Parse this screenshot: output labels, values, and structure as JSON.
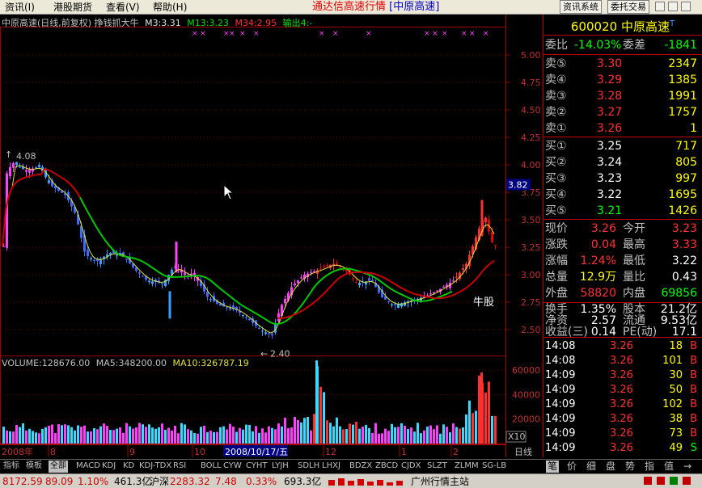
{
  "menu": [
    "资讯(I)",
    "港股期货",
    "查看(V)",
    "帮助(H)"
  ],
  "title": {
    "prefix": "通达信高速行情",
    "bracket": "[中原高速]"
  },
  "top_buttons": [
    "资讯系统",
    "委托交易"
  ],
  "chart_header": {
    "name": "中原高速(日线,前复权) 挣钱抓大牛",
    "m3": "M3:3.31",
    "m13": "M13:3.23",
    "m34": "M34:2.95",
    "out": "输出4:-"
  },
  "price_axis": [
    "5.00",
    "4.75",
    "4.50",
    "4.25",
    "4.00",
    "3.75",
    "3.50",
    "3.25",
    "3.00",
    "2.75",
    "2.50"
  ],
  "price_marker": "3.82",
  "annotations": {
    "high": "4.08",
    "low": "2.40",
    "bull": "牛股"
  },
  "volume_header": {
    "vol": "VOLUME:128676.00",
    "ma5": "MA5:348200.00",
    "ma10": "MA10:326787.19"
  },
  "volume_axis": [
    "60000",
    "40000",
    "20000"
  ],
  "volume_unit": "X10",
  "date_axis": {
    "year": "2008年",
    "months": [
      "8",
      "9",
      "10",
      "12",
      "1",
      "2"
    ],
    "cursor_date": "2008/10/17/五",
    "period": "日线"
  },
  "quote": {
    "code": "600020",
    "name": "中原高速",
    "weibi_label": "委比",
    "weibi": "-14.03%",
    "weicha_label": "委差",
    "weicha": "-1841",
    "asks": [
      {
        "label": "卖⑤",
        "price": "3.30",
        "vol": "2347"
      },
      {
        "label": "卖④",
        "price": "3.29",
        "vol": "1385"
      },
      {
        "label": "卖③",
        "price": "3.28",
        "vol": "1991"
      },
      {
        "label": "卖②",
        "price": "3.27",
        "vol": "1757"
      },
      {
        "label": "卖①",
        "price": "3.26",
        "vol": "1"
      }
    ],
    "bids": [
      {
        "label": "买①",
        "price": "3.25",
        "vol": "717"
      },
      {
        "label": "买②",
        "price": "3.24",
        "vol": "805"
      },
      {
        "label": "买③",
        "price": "3.23",
        "vol": "997"
      },
      {
        "label": "买④",
        "price": "3.22",
        "vol": "1695"
      },
      {
        "label": "买⑤",
        "price": "3.21",
        "vol": "1426"
      }
    ],
    "stats": [
      {
        "l1": "现价",
        "v1": "3.26",
        "l2": "今开",
        "v2": "3.23"
      },
      {
        "l1": "涨跌",
        "v1": "0.04",
        "l2": "最高",
        "v2": "3.33"
      },
      {
        "l1": "涨幅",
        "v1": "1.24%",
        "l2": "最低",
        "v2": "3.22"
      },
      {
        "l1": "总量",
        "v1": "12.9万",
        "l2": "量比",
        "v2": "0.43"
      },
      {
        "l1": "外盘",
        "v1": "58820",
        "l2": "内盘",
        "v2": "69856"
      }
    ],
    "stats2": [
      {
        "l1": "换手",
        "v1": "1.35%",
        "l2": "股本",
        "v2": "21.2亿"
      },
      {
        "l1": "净资",
        "v1": "2.57",
        "l2": "流通",
        "v2": "9.53亿"
      },
      {
        "l1": "收益(三)",
        "v1": "0.14",
        "l2": "PE(动)",
        "v2": "17.1"
      }
    ],
    "ticks": [
      {
        "t": "14:08",
        "p": "3.26",
        "v": "18",
        "d": "B"
      },
      {
        "t": "14:08",
        "p": "3.26",
        "v": "101",
        "d": "B"
      },
      {
        "t": "14:09",
        "p": "3.26",
        "v": "30",
        "d": "B"
      },
      {
        "t": "14:09",
        "p": "3.26",
        "v": "50",
        "d": "B"
      },
      {
        "t": "14:09",
        "p": "3.26",
        "v": "102",
        "d": "B"
      },
      {
        "t": "14:09",
        "p": "3.26",
        "v": "38",
        "d": "B"
      },
      {
        "t": "14:09",
        "p": "3.26",
        "v": "73",
        "d": "B"
      },
      {
        "t": "14:09",
        "p": "3.26",
        "v": "49",
        "d": "S"
      }
    ]
  },
  "bottom_tabs": [
    "指标",
    "模板",
    "全部",
    "MACD",
    "KDJ",
    "KD",
    "KDJ-TDX",
    "RSI",
    "BOLL",
    "CYW",
    "CYHT",
    "LYJH",
    "SDLH",
    "LHXJ",
    "BDZX",
    "ZBCD",
    "CJDX",
    "SLZT",
    "ZLMM",
    "SG-LB"
  ],
  "right_tabs": [
    "笔",
    "价",
    "细",
    "盘",
    "势",
    "指",
    "值",
    "→"
  ],
  "status": {
    "sh": "8172.59",
    "sh_chg": "89.09",
    "sh_pct": "1.10%",
    "sh_amt": "461.3亿",
    "hs_label": "沪深",
    "hs": "2283.32",
    "hs_chg": "7.48",
    "hs_pct": "0.33%",
    "hs_amt": "693.3亿",
    "site": "广州行情主站"
  },
  "colors": {
    "up": "#ff3030",
    "down": "#00ff00",
    "ma_red": "#c80000",
    "ma_green": "#00c800",
    "ma_yellow": "#e0e040"
  }
}
